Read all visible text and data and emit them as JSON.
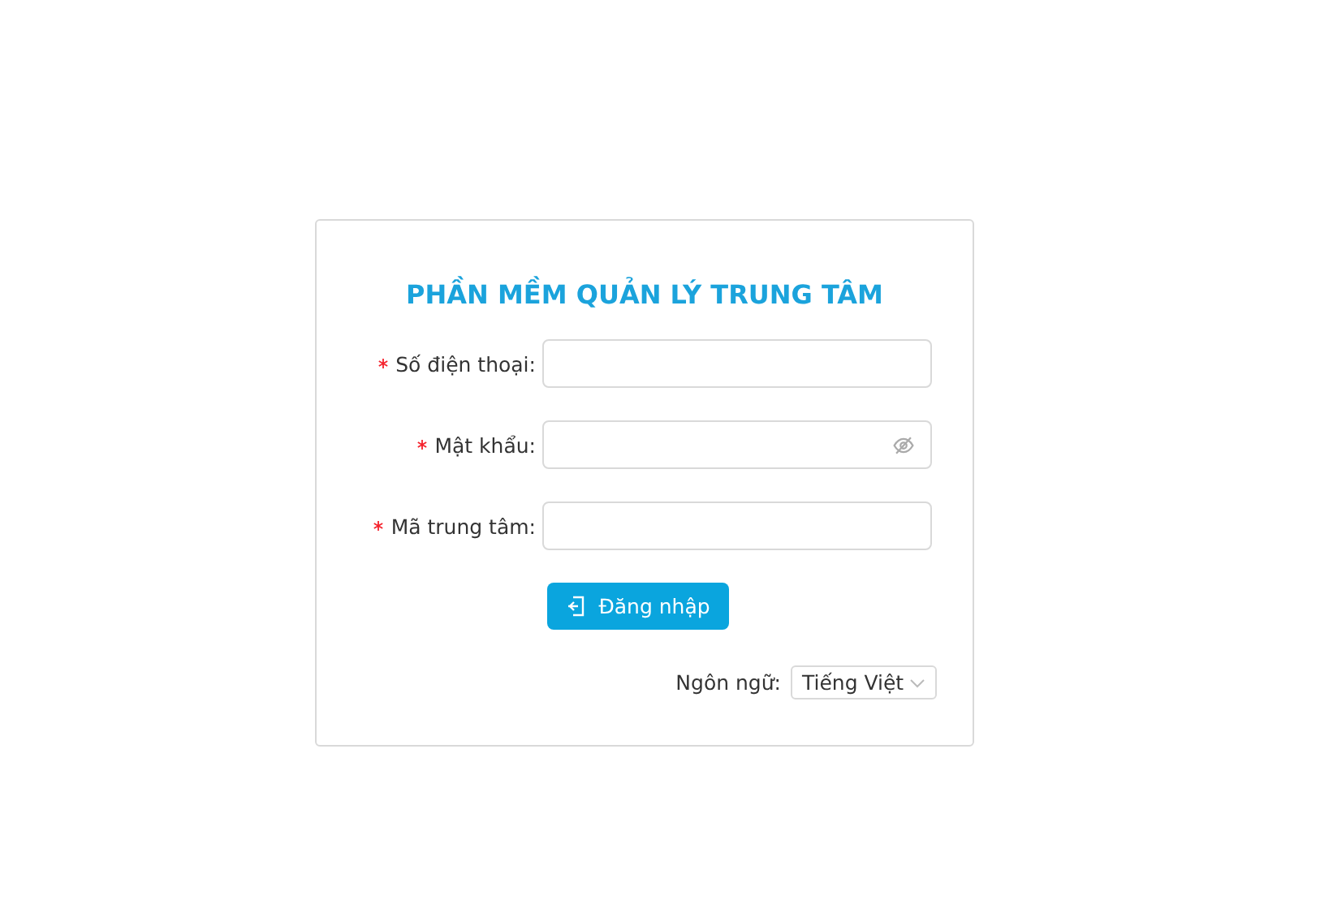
{
  "title": "PHẦN MỀM QUẢN LÝ TRUNG TÂM",
  "fields": [
    {
      "label": "Số điện thoại:",
      "required": true,
      "kind": "text"
    },
    {
      "label": "Mật khẩu:",
      "required": true,
      "kind": "password"
    },
    {
      "label": "Mã trung tâm:",
      "required": true,
      "kind": "text"
    }
  ],
  "login_button": "Đăng nhập",
  "language": {
    "label": "Ngôn ngữ:",
    "value": "Tiếng Việt"
  }
}
